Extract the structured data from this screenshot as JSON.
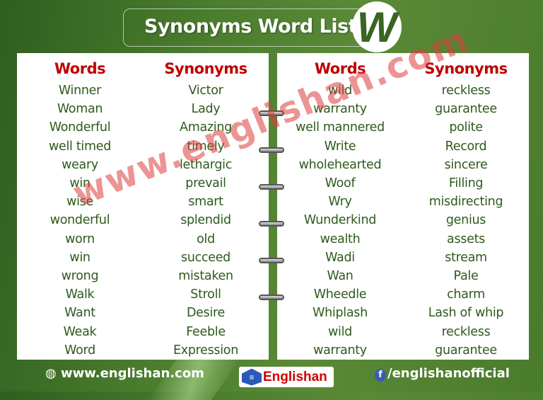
{
  "header": {
    "title": "Synonyms Word List",
    "letter": "W"
  },
  "columns": {
    "words": "Words",
    "synonyms": "Synonyms"
  },
  "left": [
    [
      "Winner",
      "Victor"
    ],
    [
      "Woman",
      "Lady"
    ],
    [
      "Wonderful",
      "Amazing"
    ],
    [
      "well timed",
      "timely"
    ],
    [
      "weary",
      "lethargic"
    ],
    [
      "win",
      "prevail"
    ],
    [
      "wise",
      "smart"
    ],
    [
      "wonderful",
      "splendid"
    ],
    [
      "worn",
      "old"
    ],
    [
      "win",
      "succeed"
    ],
    [
      "wrong",
      "mistaken"
    ],
    [
      "Walk",
      "Stroll"
    ],
    [
      "Want",
      "Desire"
    ],
    [
      "Weak",
      "Feeble"
    ],
    [
      "Word",
      "Expression"
    ]
  ],
  "right": [
    [
      "wild",
      "reckless"
    ],
    [
      "warranty",
      "guarantee"
    ],
    [
      "well mannered",
      "polite"
    ],
    [
      "Write",
      "Record"
    ],
    [
      "wholehearted",
      "sincere"
    ],
    [
      "Woof",
      "Filling"
    ],
    [
      "Wry",
      "misdirecting"
    ],
    [
      "Wunderkind",
      "genius"
    ],
    [
      "wealth",
      "assets"
    ],
    [
      "Wadi",
      "stream"
    ],
    [
      "Wan",
      "Pale"
    ],
    [
      "Wheedle",
      "charm"
    ],
    [
      "Whiplash",
      "Lash of whip"
    ],
    [
      "wild",
      "reckless"
    ],
    [
      "warranty",
      "guarantee"
    ]
  ],
  "watermark": "www.englishan.com",
  "footer": {
    "website": "www.englishan.com",
    "brand": "Englishan",
    "social": "/englishanofficial",
    "icons": [
      "globe-icon",
      "facebook-icon"
    ]
  },
  "colors": {
    "header_text": "#c00000",
    "cell_text": "#2e5a1c",
    "background": "#4b7d2e"
  }
}
